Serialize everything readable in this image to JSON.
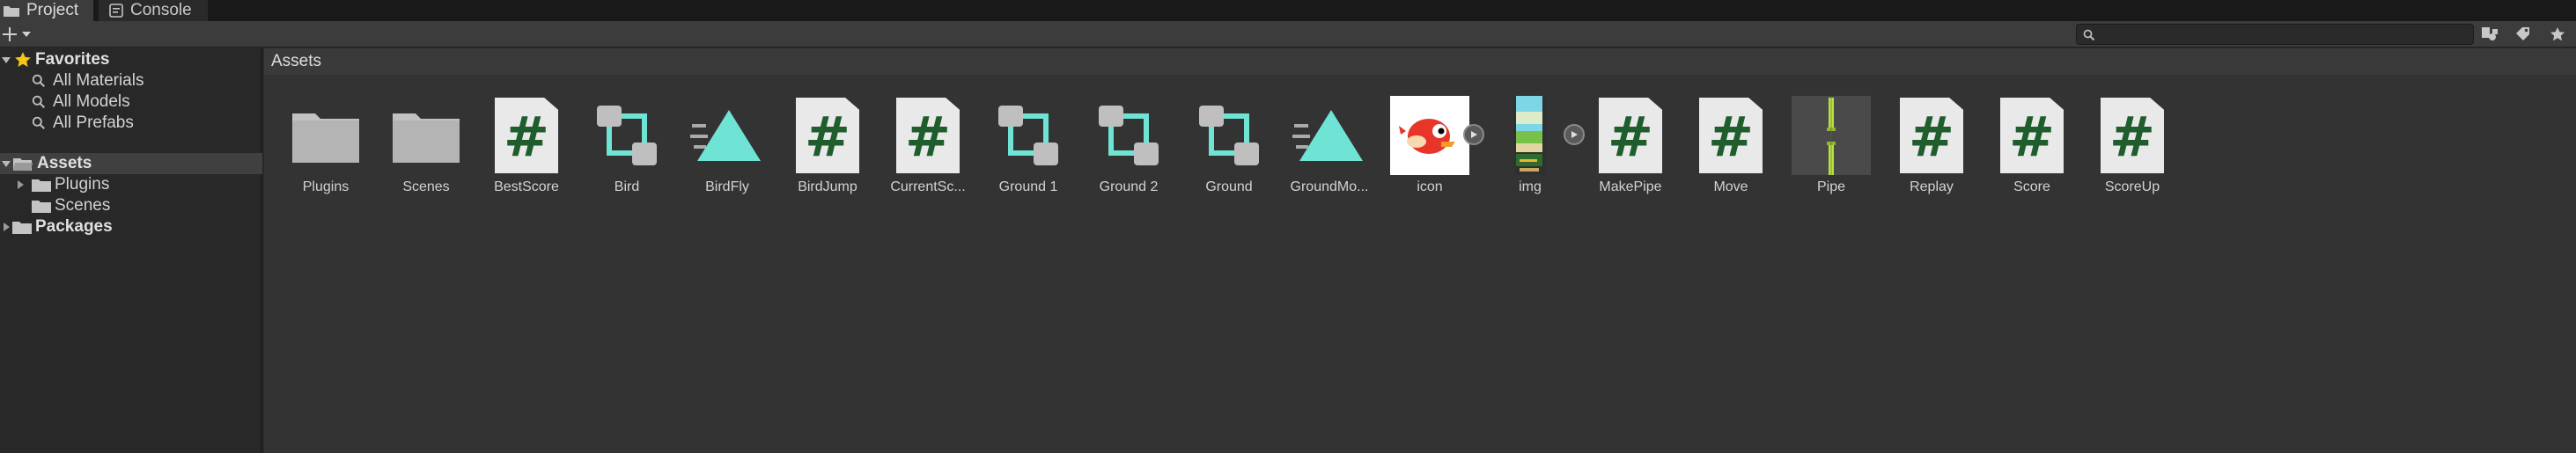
{
  "tabs": [
    {
      "label": "Project",
      "icon": "folder-icon"
    },
    {
      "label": "Console",
      "icon": "console-icon"
    }
  ],
  "toolbar": {
    "search_value": "",
    "search_placeholder": ""
  },
  "sidebar": {
    "favorites": {
      "label": "Favorites",
      "items": [
        "All Materials",
        "All Models",
        "All Prefabs"
      ]
    },
    "assets": {
      "label": "Assets",
      "children": [
        "Plugins",
        "Scenes"
      ]
    },
    "packages": {
      "label": "Packages"
    }
  },
  "breadcrumb": "Assets",
  "assets": [
    {
      "name": "Plugins",
      "type": "folder"
    },
    {
      "name": "Scenes",
      "type": "folder"
    },
    {
      "name": "BestScore",
      "type": "script"
    },
    {
      "name": "Bird",
      "type": "animator"
    },
    {
      "name": "BirdFly",
      "type": "animation"
    },
    {
      "name": "BirdJump",
      "type": "script"
    },
    {
      "name": "CurrentSc...",
      "type": "script"
    },
    {
      "name": "Ground 1",
      "type": "animator"
    },
    {
      "name": "Ground 2",
      "type": "animator"
    },
    {
      "name": "Ground",
      "type": "animator"
    },
    {
      "name": "GroundMo...",
      "type": "animation"
    },
    {
      "name": "icon",
      "type": "texture-bird"
    },
    {
      "name": "img",
      "type": "texture-img"
    },
    {
      "name": "MakePipe",
      "type": "script"
    },
    {
      "name": "Move",
      "type": "script"
    },
    {
      "name": "Pipe",
      "type": "prefab-pipe"
    },
    {
      "name": "Replay",
      "type": "script"
    },
    {
      "name": "Score",
      "type": "script"
    },
    {
      "name": "ScoreUp",
      "type": "script"
    }
  ],
  "colors": {
    "accent_teal": "#6fe3d4",
    "script_green": "#1f5d2c",
    "favorites_star": "#f5c518"
  }
}
